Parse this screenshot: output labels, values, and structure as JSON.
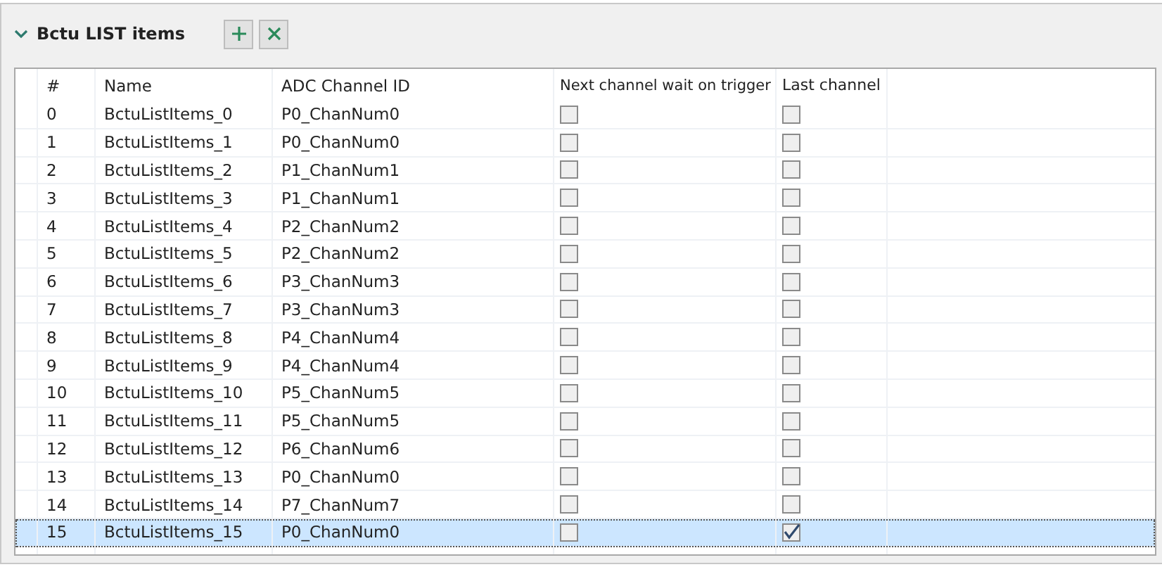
{
  "section": {
    "title": "Bctu LIST items",
    "expanded": true
  },
  "columns": [
    "#",
    "Name",
    "ADC Channel ID",
    "Next channel wait on trigger",
    "Last channel"
  ],
  "rows": [
    {
      "index": "0",
      "name": "BctuListItems_0",
      "channel": "P0_ChanNum0",
      "wait_on_trigger": false,
      "last_channel": false,
      "selected": false
    },
    {
      "index": "1",
      "name": "BctuListItems_1",
      "channel": "P0_ChanNum0",
      "wait_on_trigger": false,
      "last_channel": false,
      "selected": false
    },
    {
      "index": "2",
      "name": "BctuListItems_2",
      "channel": "P1_ChanNum1",
      "wait_on_trigger": false,
      "last_channel": false,
      "selected": false
    },
    {
      "index": "3",
      "name": "BctuListItems_3",
      "channel": "P1_ChanNum1",
      "wait_on_trigger": false,
      "last_channel": false,
      "selected": false
    },
    {
      "index": "4",
      "name": "BctuListItems_4",
      "channel": "P2_ChanNum2",
      "wait_on_trigger": false,
      "last_channel": false,
      "selected": false
    },
    {
      "index": "5",
      "name": "BctuListItems_5",
      "channel": "P2_ChanNum2",
      "wait_on_trigger": false,
      "last_channel": false,
      "selected": false
    },
    {
      "index": "6",
      "name": "BctuListItems_6",
      "channel": "P3_ChanNum3",
      "wait_on_trigger": false,
      "last_channel": false,
      "selected": false
    },
    {
      "index": "7",
      "name": "BctuListItems_7",
      "channel": "P3_ChanNum3",
      "wait_on_trigger": false,
      "last_channel": false,
      "selected": false
    },
    {
      "index": "8",
      "name": "BctuListItems_8",
      "channel": "P4_ChanNum4",
      "wait_on_trigger": false,
      "last_channel": false,
      "selected": false
    },
    {
      "index": "9",
      "name": "BctuListItems_9",
      "channel": "P4_ChanNum4",
      "wait_on_trigger": false,
      "last_channel": false,
      "selected": false
    },
    {
      "index": "10",
      "name": "BctuListItems_10",
      "channel": "P5_ChanNum5",
      "wait_on_trigger": false,
      "last_channel": false,
      "selected": false
    },
    {
      "index": "11",
      "name": "BctuListItems_11",
      "channel": "P5_ChanNum5",
      "wait_on_trigger": false,
      "last_channel": false,
      "selected": false
    },
    {
      "index": "12",
      "name": "BctuListItems_12",
      "channel": "P6_ChanNum6",
      "wait_on_trigger": false,
      "last_channel": false,
      "selected": false
    },
    {
      "index": "13",
      "name": "BctuListItems_13",
      "channel": "P0_ChanNum0",
      "wait_on_trigger": false,
      "last_channel": false,
      "selected": false
    },
    {
      "index": "14",
      "name": "BctuListItems_14",
      "channel": "P7_ChanNum7",
      "wait_on_trigger": false,
      "last_channel": false,
      "selected": false
    },
    {
      "index": "15",
      "name": "BctuListItems_15",
      "channel": "P0_ChanNum0",
      "wait_on_trigger": false,
      "last_channel": true,
      "selected": true
    }
  ]
}
